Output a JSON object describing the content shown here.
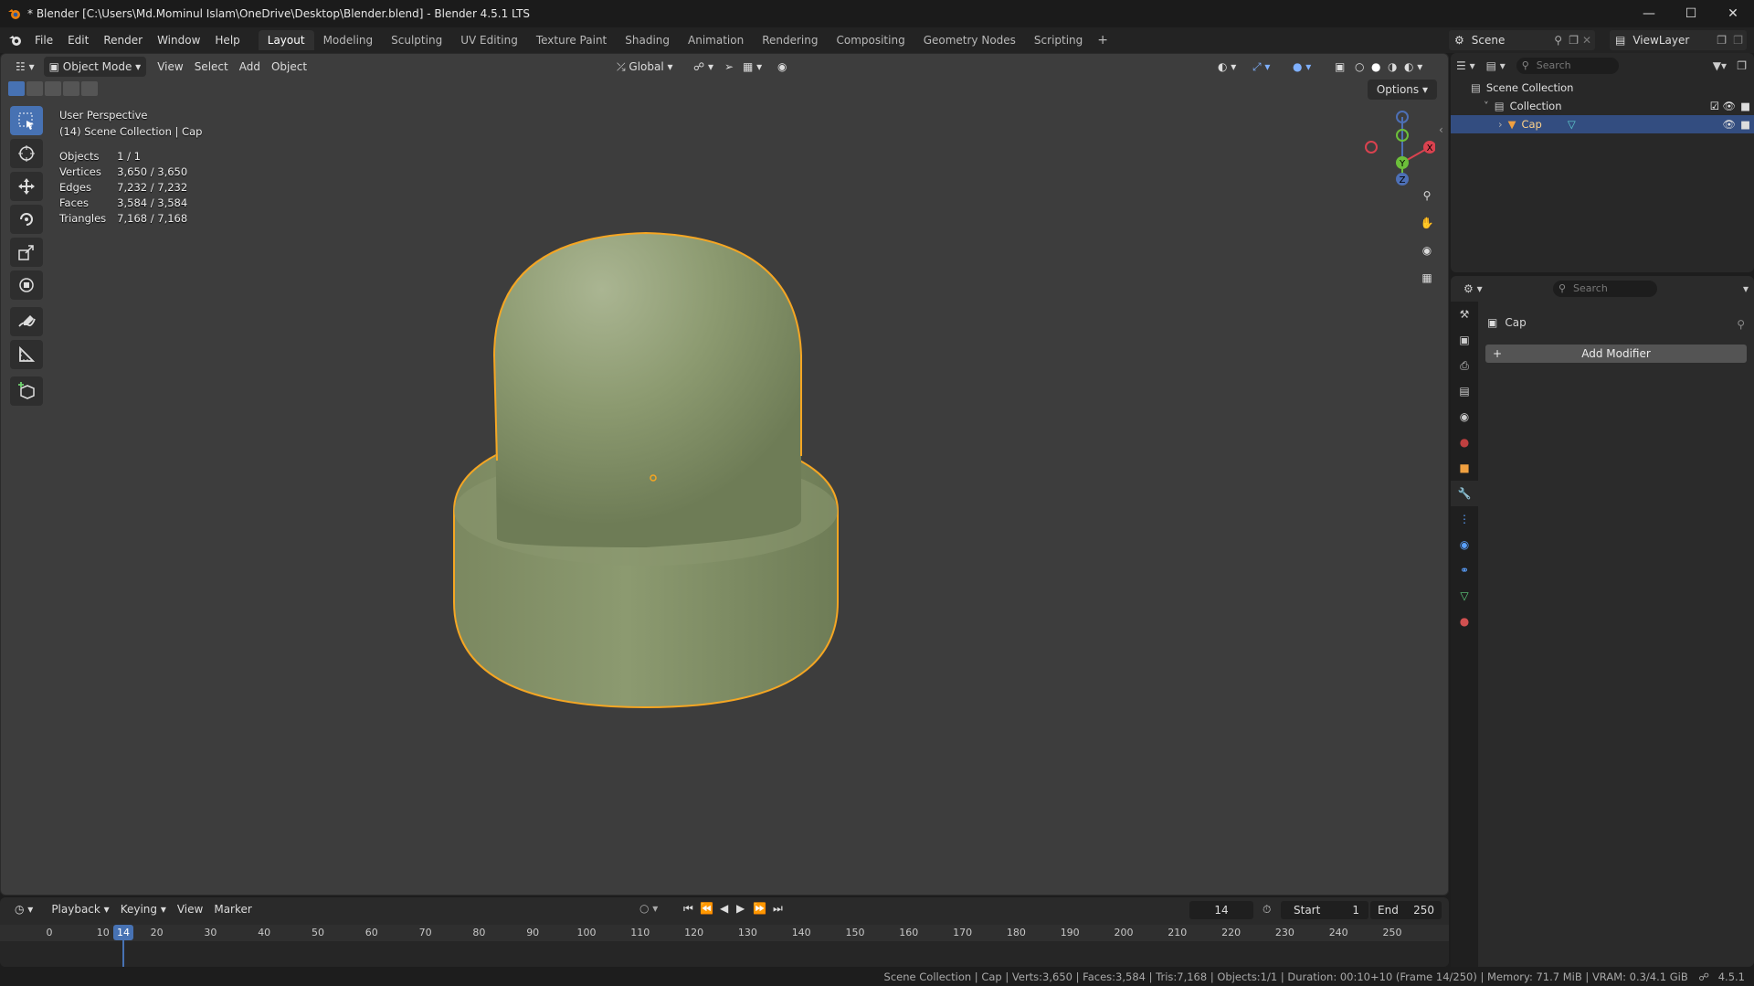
{
  "window": {
    "title": "* Blender [C:\\Users\\Md.Mominul Islam\\OneDrive\\Desktop\\Blender.blend] - Blender 4.5.1 LTS"
  },
  "menus": [
    "File",
    "Edit",
    "Render",
    "Window",
    "Help"
  ],
  "workspaces": [
    "Layout",
    "Modeling",
    "Sculpting",
    "UV Editing",
    "Texture Paint",
    "Shading",
    "Animation",
    "Rendering",
    "Compositing",
    "Geometry Nodes",
    "Scripting"
  ],
  "active_workspace": "Layout",
  "scene": {
    "name": "Scene",
    "view_layer": "ViewLayer"
  },
  "viewport": {
    "mode": "Object Mode",
    "menus": [
      "View",
      "Select",
      "Add",
      "Object"
    ],
    "transform_orientation": "Global",
    "options_label": "Options",
    "view_name": "User Perspective",
    "context": "(14) Scene Collection | Cap",
    "stats": [
      {
        "label": "Objects",
        "value": "1 / 1"
      },
      {
        "label": "Vertices",
        "value": "3,650 / 3,650"
      },
      {
        "label": "Edges",
        "value": "7,232 / 7,232"
      },
      {
        "label": "Faces",
        "value": "3,584 / 3,584"
      },
      {
        "label": "Triangles",
        "value": "7,168 / 7,168"
      }
    ],
    "gizmo_axes": {
      "x": "X",
      "y": "Y",
      "z": "Z"
    },
    "object_color": "#8a9a6c",
    "outline_color": "#f5a623"
  },
  "outliner": {
    "search_placeholder": "Search",
    "root": "Scene Collection",
    "collection": "Collection",
    "object": "Cap"
  },
  "properties": {
    "search_placeholder": "Search",
    "object_name": "Cap",
    "add_modifier": "Add Modifier"
  },
  "timeline": {
    "menus": [
      "Playback",
      "Keying",
      "View",
      "Marker"
    ],
    "current_frame": "14",
    "start_label": "Start",
    "start_value": "1",
    "end_label": "End",
    "end_value": "250",
    "ticks": [
      "0",
      "10",
      "20",
      "30",
      "40",
      "50",
      "60",
      "70",
      "80",
      "90",
      "100",
      "110",
      "120",
      "130",
      "140",
      "150",
      "160",
      "170",
      "180",
      "190",
      "200",
      "210",
      "220",
      "230",
      "240",
      "250"
    ]
  },
  "statusbar": {
    "text": "Scene Collection | Cap | Verts:3,650 | Faces:3,584 | Tris:7,168 | Objects:1/1 | Duration: 00:10+10 (Frame 14/250) | Memory: 71.7 MiB | VRAM: 0.3/4.1 GiB",
    "version": "4.5.1"
  }
}
